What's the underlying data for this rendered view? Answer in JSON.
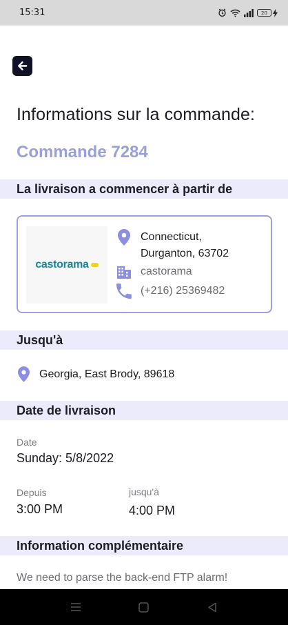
{
  "status_bar": {
    "time": "15:31",
    "battery_level": "20",
    "icons": [
      "alarm-icon",
      "wifi-icon",
      "signal-icon",
      "battery-icon",
      "charging-icon"
    ]
  },
  "header": {
    "back_icon": "arrow-left-icon",
    "title": "Informations sur la commande:",
    "order_number": "Commande 7284"
  },
  "pickup": {
    "section_title": "La livraison a commencer à partir de",
    "store_logo_text": "castorama",
    "address_line1": "Connecticut,",
    "address_line2": "Durganton, 63702",
    "store_name": "castorama",
    "phone": "(+216) 25369482"
  },
  "destination": {
    "section_title": "Jusqu'à",
    "address": "Georgia, East Brody, 89618"
  },
  "delivery_date": {
    "section_title": "Date de livraison",
    "date_label": "Date",
    "date_value": "Sunday: 5/8/2022",
    "from_label": "Depuis",
    "from_value": "3:00 PM",
    "to_label": "jusqu'à",
    "to_value": "4:00 PM"
  },
  "additional_info": {
    "section_title": "Information complémentaire",
    "text": "We need to parse the back-end FTP alarm!"
  },
  "nav_bar": {
    "icons": [
      "menu-icon",
      "home-icon",
      "back-triangle-icon"
    ]
  },
  "colors": {
    "accent": "#8a8fe0",
    "order_number": "#9aa0d8",
    "section_bg": "#ecebfb",
    "card_border": "#9da2d6",
    "back_button": "#111126",
    "logo_teal": "#17869b",
    "logo_yellow": "#f2d21c"
  }
}
